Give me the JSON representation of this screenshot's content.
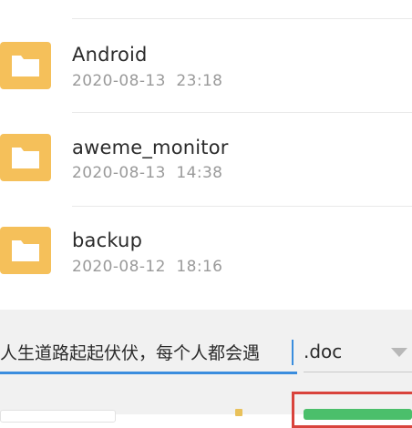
{
  "files": [
    {
      "name": "Android",
      "date": "2020-08-13  23:18",
      "icon": "folder-icon"
    },
    {
      "name": "aweme_monitor",
      "date": "2020-08-13  14:38",
      "icon": "folder-icon"
    },
    {
      "name": "backup",
      "date": "2020-08-12  18:16",
      "icon": "folder-icon"
    }
  ],
  "save_dialog": {
    "filename_value": "人生道路起起伏伏，每个人都会遇",
    "extension": ".doc"
  },
  "colors": {
    "folder": "#f5c05a",
    "accent": "#3a8dde",
    "confirm": "#4bbf6b",
    "highlight": "#d9433c"
  }
}
